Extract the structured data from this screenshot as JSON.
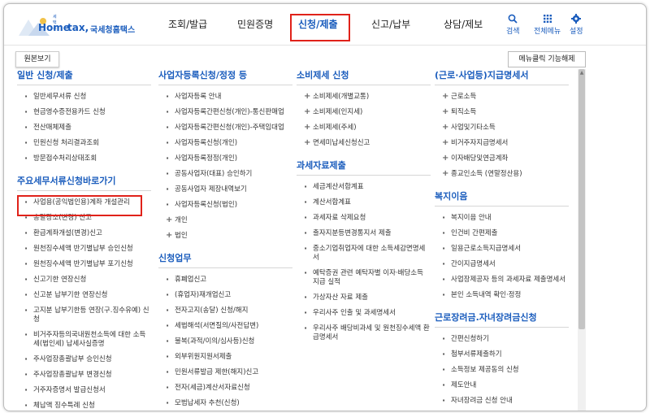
{
  "header": {
    "logo": {
      "small": "세택스",
      "hometax": "Home",
      "tax": "tax,",
      "name": "국세청홈택스"
    },
    "nav": [
      "조회/발급",
      "민원증명",
      "신청/제출",
      "신고/납부",
      "상담/제보"
    ],
    "active_nav_index": 2,
    "utils": [
      {
        "label": "검색",
        "icon": "search-icon"
      },
      {
        "label": "전체메뉴",
        "icon": "grid-menu-icon"
      },
      {
        "label": "설정",
        "icon": "gear-icon"
      }
    ]
  },
  "origin_button": "원본보기",
  "cancel_button": "메뉴클릭 기능해제",
  "colors": {
    "accent": "#1b5dbd",
    "highlight": "#e0221a"
  },
  "columns": [
    {
      "sections": [
        {
          "title": "일반 신청/제출",
          "marker": "dot",
          "items": [
            "일반세무서류 신청",
            "현금영수증전용카드 신청",
            "전산매체제출",
            "민원신청 처리결과조회",
            "방문접수처리상태조회"
          ]
        },
        {
          "title": "주요세무서류신청바로가기",
          "marker": "dot",
          "items": [
            "사업용(공익법인용)계좌 개설관리",
            "송달장소(변경) 신고",
            "환급계좌개설(변경)신고",
            "원천징수세액 반기별납부 승인신청",
            "원천징수세액 반기별납부 포기신청",
            "신고기한 연장신청",
            "신고분 납부기한 연장신청",
            "고지분 납부기한등 연장(구.징수유예) 신청",
            "비거주자등의국내원천소득에 대한 소득세(법인세) 납세사실증명",
            "주사업장총괄납부 승인신청",
            "주사업장총괄납부 변경신청",
            "거주자증명서 발급신청서",
            "체납액 징수특례 신청"
          ]
        }
      ]
    },
    {
      "sections": [
        {
          "title": "사업자등록신청/정정 등",
          "marker": "dot",
          "items": [
            "사업자등록 안내",
            "사업자등록간편신청(개인)-통신판매업",
            "사업자등록간편신청(개인)-주택임대업",
            "사업자등록신청(개인)",
            "사업자등록정정(개인)",
            "공동사업자(대표) 승인하기",
            "공동사업자 제장내역보기",
            "사업자등록신청(법인)"
          ]
        },
        {
          "title": "",
          "marker": "plus",
          "items": [
            "개인",
            "법인"
          ]
        },
        {
          "title": "신청업무",
          "marker": "dot",
          "items": [
            "휴폐업신고",
            "(휴업자)재개업신고",
            "전자고지(송달) 신청/해지",
            "세법해석(서면질의/사전답변)",
            "불복(과적/이의/심사등)신청",
            "외부위원지원서제출",
            "민원서류발급 제한(해지)신고",
            "전자(세금)계산서자료신청",
            "모범납세자 추천(신청)"
          ]
        }
      ]
    },
    {
      "sections": [
        {
          "title": "소비제세 신청",
          "marker": "plus",
          "items": [
            "소비제세(개별교통)",
            "소비제세(인지세)",
            "소비제세(주세)",
            "면세미납세신청신고"
          ]
        },
        {
          "title": "과세자료제출",
          "marker": "dot",
          "items": [
            "세금계산서합계표",
            "계산서합계표",
            "과세자료 삭제요청",
            "출자지분등변경통지서 제출",
            "중소기업취업자에 대한 소득세감면명세서",
            "예탁증권 관련 예탁자별 이자·배당소득 지급 실적",
            "가상자산 자료 제출",
            "우리사주 인출 및 과세명세서",
            "우리사주 배당비과세 및 원천징수세액 환급명세서"
          ]
        }
      ]
    },
    {
      "sections": [
        {
          "title": "(근로·사업등)지급명세서",
          "marker": "plus",
          "items": [
            "근로소득",
            "퇴직소득",
            "사업및기타소득",
            "비거주자지급명세서",
            "이자배당및연금계좌",
            "종교인소득 (연말정산용)"
          ]
        },
        {
          "title": "복지이음",
          "marker": "dot",
          "items": [
            "복지이음 안내",
            "인건비 간편제출",
            "일용근로소득지급명세서",
            "간이지급명세서",
            "사업장제공자 등의 과세자료 제출명세서",
            "본인 소득내역 확인·정정"
          ]
        },
        {
          "title": "근로장려금.자녀장려금신청",
          "marker": "dot",
          "items": [
            "간편신청하기",
            "첨부서류제출하기",
            "소득정보 제공동의 신청",
            "제도안내",
            "자녀장려금 신청 안내"
          ]
        }
      ]
    }
  ]
}
